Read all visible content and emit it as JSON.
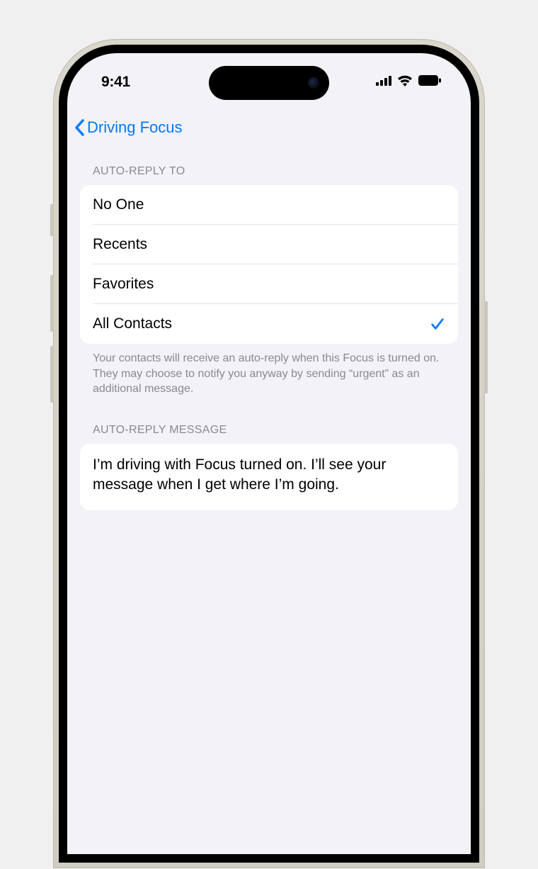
{
  "status": {
    "time": "9:41"
  },
  "nav": {
    "back_label": "Driving Focus"
  },
  "auto_reply_to": {
    "header": "Auto-Reply To",
    "options": {
      "0": {
        "label": "No One",
        "selected": false
      },
      "1": {
        "label": "Recents",
        "selected": false
      },
      "2": {
        "label": "Favorites",
        "selected": false
      },
      "3": {
        "label": "All Contacts",
        "selected": true
      }
    },
    "footer": "Your contacts will receive an auto-reply when this Focus is turned on. They may choose to notify you anyway by sending “urgent” as an additional message."
  },
  "auto_reply_message": {
    "header": "Auto-Reply Message",
    "text": "I’m driving with Focus turned on. I’ll see your message when I get where I’m going."
  }
}
